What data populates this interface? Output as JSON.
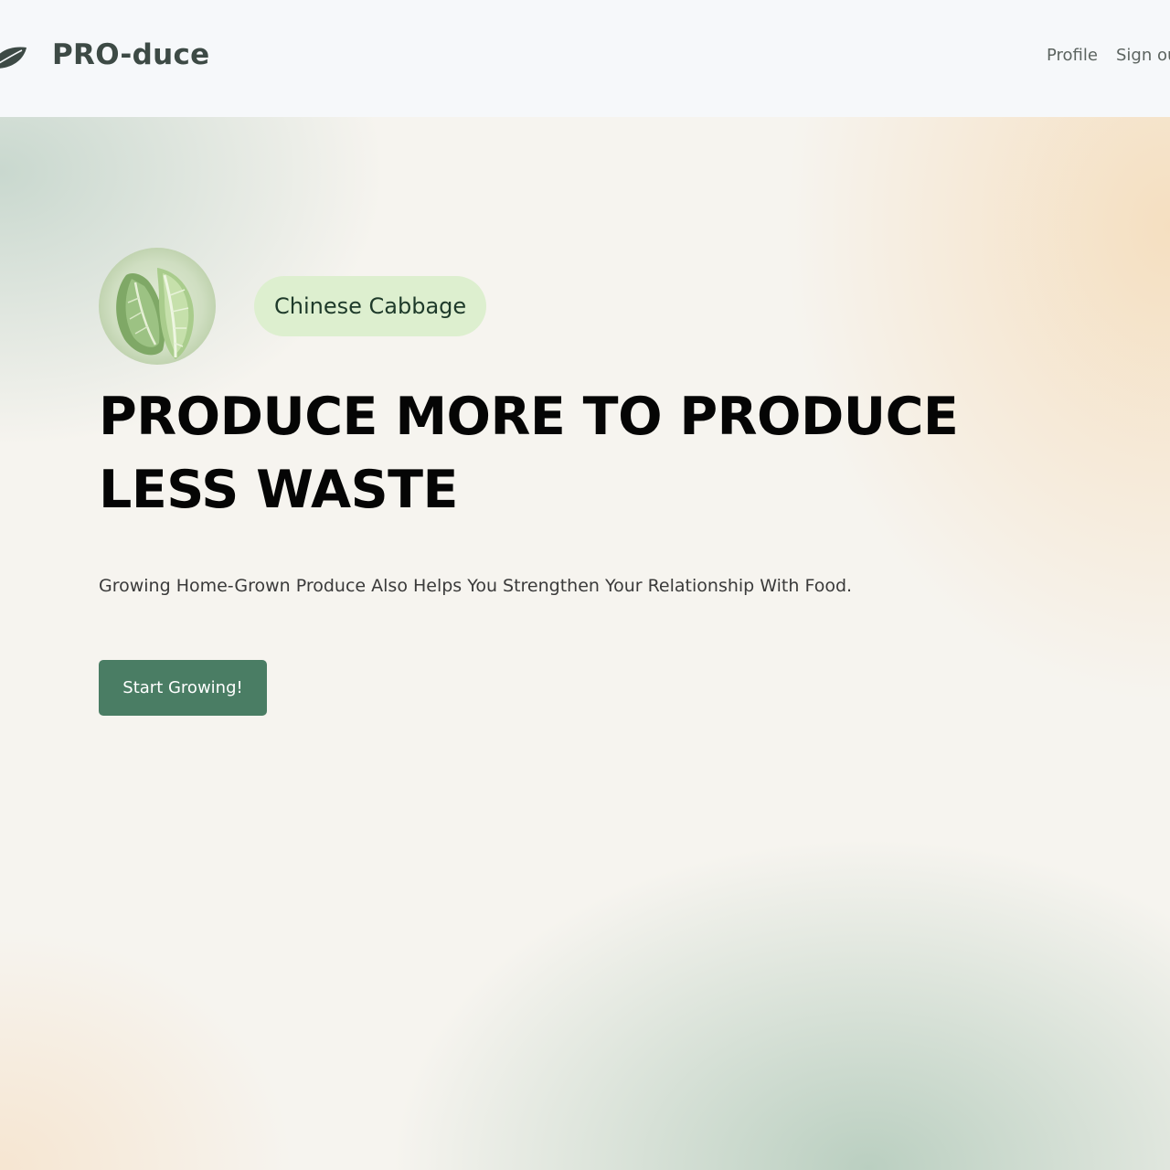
{
  "navbar": {
    "brand_name": "PRO-duce",
    "brand_icon": "leaf-icon",
    "links": [
      {
        "label": "Profile"
      },
      {
        "label": "Sign out"
      }
    ]
  },
  "hero": {
    "produce_image": "cabbage-image",
    "tag_label": "Chinese Cabbage",
    "headline": "PRODUCE MORE TO PRODUCE LESS WASTE",
    "subtext": "Growing Home-Grown Produce Also Helps You Strengthen Your Relationship With Food.",
    "cta_label": "Start Growing!"
  },
  "colors": {
    "navbar_bg": "#f6f8fa",
    "brand_text": "#3d4a45",
    "tag_bg": "#ddefcf",
    "cta_bg": "#4a7d64",
    "headline": "#050505"
  }
}
